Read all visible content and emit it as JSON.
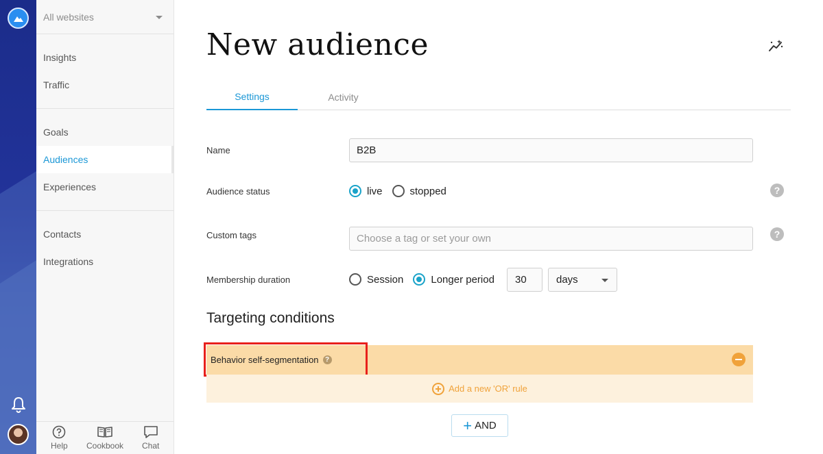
{
  "sidebar": {
    "site_selector": "All websites",
    "groups": [
      [
        {
          "label": "Insights"
        },
        {
          "label": "Traffic"
        }
      ],
      [
        {
          "label": "Goals"
        },
        {
          "label": "Audiences"
        },
        {
          "label": "Experiences"
        }
      ],
      [
        {
          "label": "Contacts"
        },
        {
          "label": "Integrations"
        }
      ]
    ],
    "active_item": "Audiences",
    "bottom": [
      {
        "label": "Help",
        "icon": "help-circle-icon"
      },
      {
        "label": "Cookbook",
        "icon": "book-icon"
      },
      {
        "label": "Chat",
        "icon": "chat-icon"
      }
    ]
  },
  "page": {
    "title": "New audience",
    "tabs": [
      {
        "label": "Settings"
      },
      {
        "label": "Activity"
      }
    ],
    "active_tab": "Settings"
  },
  "form": {
    "name_label": "Name",
    "name_value": "B2B",
    "status_label": "Audience status",
    "status_options": [
      "live",
      "stopped"
    ],
    "status_selected": "live",
    "tags_label": "Custom tags",
    "tags_placeholder": "Choose a tag or set your own",
    "duration_label": "Membership duration",
    "duration_options": [
      "Session",
      "Longer period"
    ],
    "duration_selected": "Longer period",
    "duration_value": "30",
    "duration_unit": "days"
  },
  "targeting": {
    "title": "Targeting conditions",
    "condition_label": "Behavior self-segmentation",
    "or_rule_label": "Add a new 'OR' rule",
    "and_button": "AND"
  },
  "colors": {
    "accent": "#1a97d6",
    "condition_bg": "#fbdba7",
    "or_bg": "#fdf1dd",
    "orange": "#f0a23a",
    "highlight": "#e8201b"
  }
}
